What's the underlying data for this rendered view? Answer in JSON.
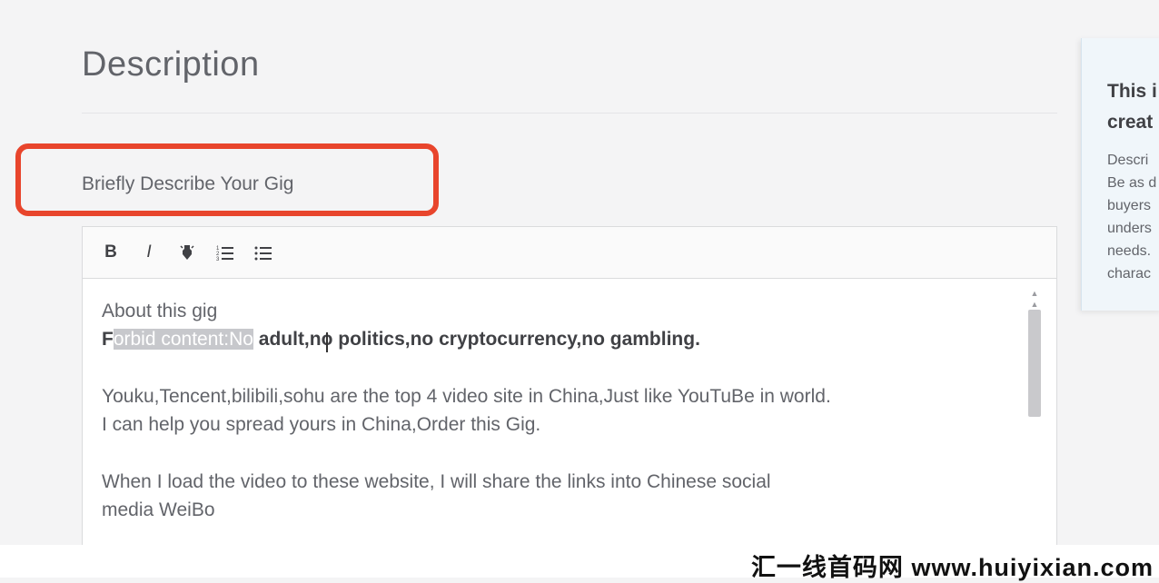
{
  "header": {
    "title": "Description"
  },
  "section": {
    "label": "Briefly Describe Your Gig"
  },
  "toolbar": {
    "bold": "B",
    "italic": "I",
    "highlight": "✎",
    "ordered_list": "☰",
    "bullet_list": "☰"
  },
  "editor": {
    "line1": "About this gig",
    "line2_start": "F",
    "line2_selected": "orbid content:No",
    "line2_rest": " adult,no politics,no cryptocurrency,no gambling.",
    "para2_line1": "Youku,Tencent,bilibili,sohu are the top 4 video site in China,Just like YouTuBe in world.",
    "para2_line2": "I can help you spread yours in China,Order this Gig.",
    "para3_line1": "When I load the video to these website, I will share the links into Chinese social",
    "para3_line2": "media WeiBo"
  },
  "tip": {
    "title": "This i\ncreat",
    "body": "Descri\nBe as d\nbuyers\nunders\nneeds.\ncharac"
  },
  "watermark": "汇一线首码网 www.huiyixian.com",
  "colors": {
    "highlight_box": "#e8452c"
  },
  "icons": [
    "bold-icon",
    "italic-icon",
    "highlight-icon",
    "ordered-list-icon",
    "bullet-list-icon"
  ]
}
